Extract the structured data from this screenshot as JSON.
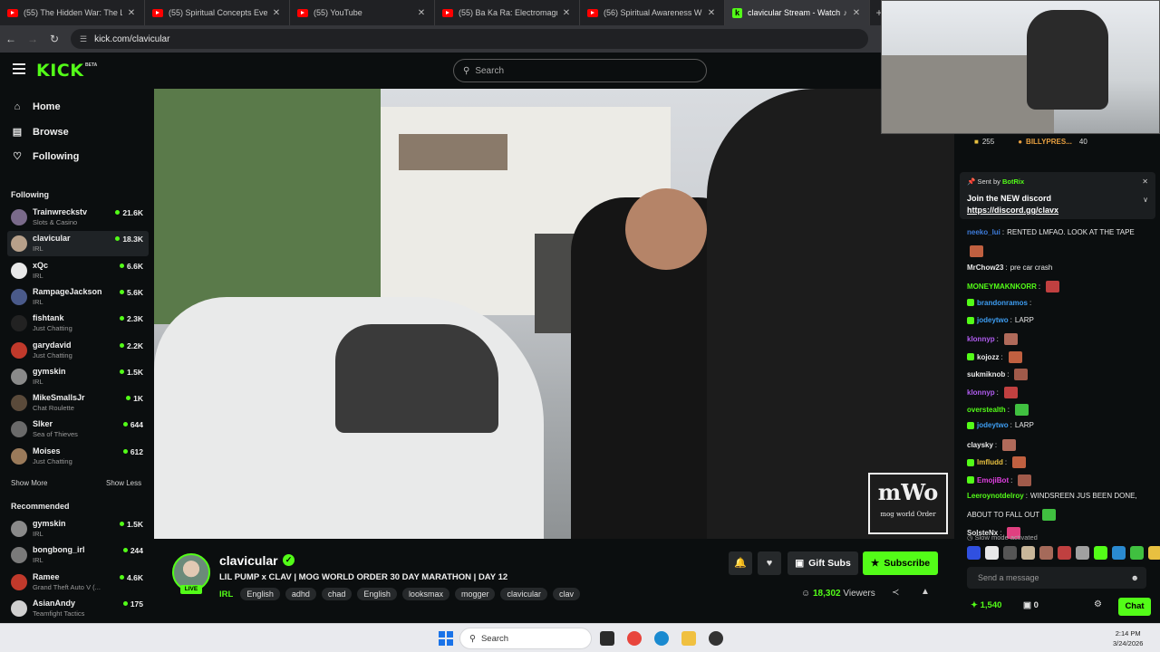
{
  "browser": {
    "tabs": [
      {
        "title": "(55) The Hidden War: The Loos",
        "icon": "youtube-icon"
      },
      {
        "title": "(55) Spiritual Concepts Everyone",
        "icon": "youtube-icon"
      },
      {
        "title": "(55) YouTube",
        "icon": "youtube-icon"
      },
      {
        "title": "(55) Ba Ka Ra: Electromagnetic",
        "icon": "youtube-icon"
      },
      {
        "title": "(56) Spiritual Awareness Will Ru",
        "icon": "youtube-icon"
      },
      {
        "title": "clavicular Stream - Watch Li",
        "icon": "kick-icon",
        "active": true
      }
    ],
    "url": "kick.com/clavicular"
  },
  "header": {
    "logo": "KICK",
    "logo_badge": "BETA",
    "search_placeholder": "Search"
  },
  "sidebar": {
    "nav": [
      {
        "label": "Home",
        "icon": "home-icon"
      },
      {
        "label": "Browse",
        "icon": "browse-icon"
      },
      {
        "label": "Following",
        "icon": "heart-icon"
      }
    ],
    "following_title": "Following",
    "following": [
      {
        "name": "Trainwreckstv",
        "category": "Slots & Casino",
        "viewers": "21.6K",
        "avatar_color": "#7a6a8a"
      },
      {
        "name": "clavicular",
        "category": "IRL",
        "viewers": "18.3K",
        "avatar_color": "#b7a08a"
      },
      {
        "name": "xQc",
        "category": "IRL",
        "viewers": "6.6K",
        "avatar_color": "#e8e8e8"
      },
      {
        "name": "RampageJackson",
        "category": "IRL",
        "viewers": "5.6K",
        "avatar_color": "#4a5a8a"
      },
      {
        "name": "fishtank",
        "category": "Just Chatting",
        "viewers": "2.3K",
        "avatar_color": "#222222"
      },
      {
        "name": "garydavid",
        "category": "Just Chatting",
        "viewers": "2.2K",
        "avatar_color": "#c0392b"
      },
      {
        "name": "gymskin",
        "category": "IRL",
        "viewers": "1.5K",
        "avatar_color": "#8a8a8a"
      },
      {
        "name": "MikeSmallsJr",
        "category": "Chat Roulette",
        "viewers": "1K",
        "avatar_color": "#5a4a3a"
      },
      {
        "name": "Slker",
        "category": "Sea of Thieves",
        "viewers": "644",
        "avatar_color": "#6a6a6a"
      },
      {
        "name": "Moises",
        "category": "Just Chatting",
        "viewers": "612",
        "avatar_color": "#9a7a5a"
      }
    ],
    "show_more": "Show More",
    "show_less": "Show Less",
    "recommended_title": "Recommended",
    "recommended": [
      {
        "name": "gymskin",
        "category": "IRL",
        "viewers": "1.5K",
        "avatar_color": "#8a8a8a"
      },
      {
        "name": "bongbong_irl",
        "category": "IRL",
        "viewers": "244",
        "avatar_color": "#7a7a7a"
      },
      {
        "name": "Ramee",
        "category": "Grand Theft Auto V (...",
        "viewers": "4.6K",
        "avatar_color": "#c0392b"
      },
      {
        "name": "AsianAndy",
        "category": "Teamfight Tactics",
        "viewers": "175",
        "avatar_color": "#d0d0d0"
      }
    ]
  },
  "video": {
    "watermark_main": "mWo",
    "watermark_sub": "mog world Order"
  },
  "stream": {
    "channel": "clavicular",
    "live_label": "LIVE",
    "title": "LIL PUMP x CLAV | MOG WORLD ORDER 30 DAY MARATHON | DAY 12",
    "category": "IRL",
    "tags": [
      "English",
      "adhd",
      "chad",
      "English",
      "looksmax",
      "mogger",
      "clavicular",
      "clav"
    ],
    "gift_label": "Gift Subs",
    "subscribe_label": "Subscribe",
    "viewers": "18,302",
    "viewers_label": "Viewers"
  },
  "chat": {
    "top_count": "255",
    "top_user": "BILLYPRES...",
    "top_user_count": "40",
    "pinned": {
      "sent_by_label": "Sent by",
      "sent_by": "BotRix",
      "line1": "Join the NEW discord",
      "line2": "https://discord.gg/clavx"
    },
    "messages": [
      {
        "user": "neeko_lui",
        "color": "#3d7bd9",
        "text": "RENTED LMFAO. LOOK AT THE TAPE",
        "emote": false
      },
      {
        "user": "",
        "color": "#e8e8e8",
        "text": "",
        "emote": true
      },
      {
        "user": "MrChow23",
        "color": "#e8e8e8",
        "text": "pre car crash",
        "emote": false
      },
      {
        "user": "MONEYMAKNKORR",
        "color": "#53fc18",
        "text": "",
        "emote": true
      },
      {
        "user": "brandonramos",
        "color": "#3d9cf0",
        "text": "",
        "emote": false,
        "badge": true
      },
      {
        "user": "jodeytwo",
        "color": "#3d9cf0",
        "text": "LARP",
        "emote": false,
        "badge": true
      },
      {
        "user": "klonnyp",
        "color": "#b05cf0",
        "text": "",
        "emote": true
      },
      {
        "user": "kojozz",
        "color": "#e8e8e8",
        "text": "",
        "emote": true,
        "badge": true
      },
      {
        "user": "sukmiknob",
        "color": "#e8e8e8",
        "text": "",
        "emote": true
      },
      {
        "user": "klonnyp",
        "color": "#b05cf0",
        "text": "",
        "emote": true
      },
      {
        "user": "overstealth",
        "color": "#53fc18",
        "text": "",
        "emote": true
      },
      {
        "user": "jodeytwo",
        "color": "#3d9cf0",
        "text": "LARP",
        "emote": false,
        "badge": true
      },
      {
        "user": "claysky",
        "color": "#e8e8e8",
        "text": "",
        "emote": true
      },
      {
        "user": "lmfludd",
        "color": "#e8c040",
        "text": "",
        "emote": true,
        "badge": true
      },
      {
        "user": "EmojiBot",
        "color": "#e040e0",
        "text": "",
        "emote": true,
        "badge": true
      },
      {
        "user": "Leeroynotdelroy",
        "color": "#53fc18",
        "text": "WINDSREEN JUS BEEN DONE,",
        "emote": false
      },
      {
        "user": "",
        "color": "#e8e8e8",
        "text": "ABOUT TO FALL OUT",
        "emote": true
      },
      {
        "user": "SolsteNx",
        "color": "#e8e8e8",
        "text": "",
        "emote": true
      }
    ],
    "slow_mode": "Slow mode activated",
    "input_placeholder": "Send a message",
    "points": "1,540",
    "points2": "0",
    "chat_button": "Chat"
  },
  "taskbar": {
    "search_label": "Search",
    "time": "2:14 PM",
    "date": "3/24/2026"
  }
}
